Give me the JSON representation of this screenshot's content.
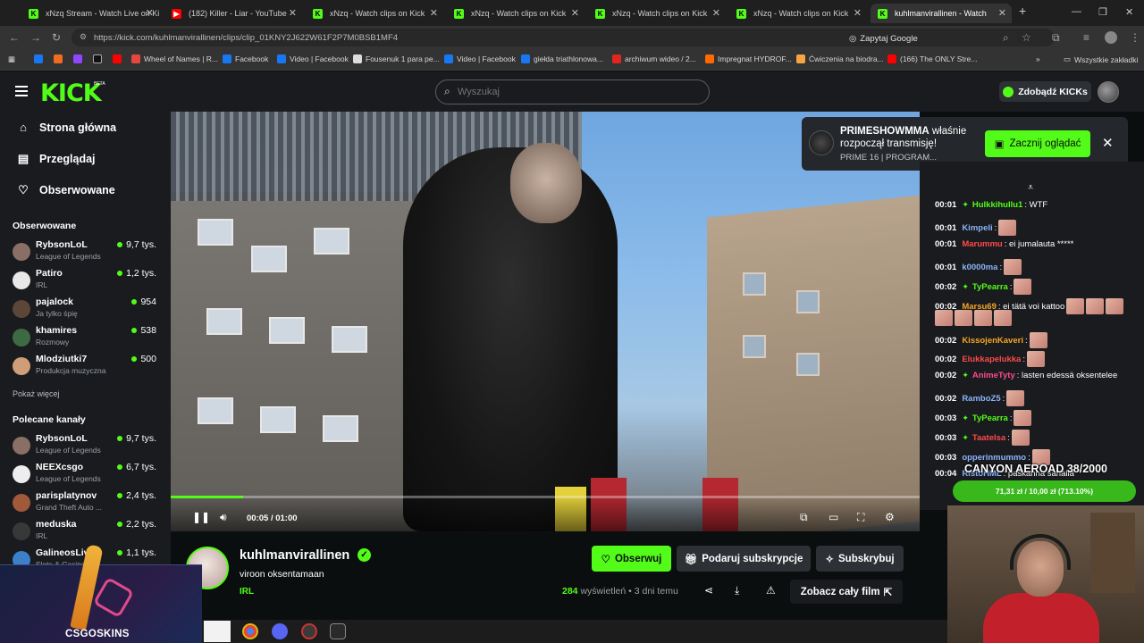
{
  "browser": {
    "tabs": [
      {
        "title": "xNzq Stream - Watch Live on Kick",
        "color": "#53fc18"
      },
      {
        "title": "(182) Killer - Liar - YouTube",
        "color": "#ff0000"
      },
      {
        "title": "xNzq - Watch clips on Kick",
        "color": "#53fc18"
      },
      {
        "title": "xNzq - Watch clips on Kick",
        "color": "#53fc18"
      },
      {
        "title": "xNzq - Watch clips on Kick",
        "color": "#53fc18"
      },
      {
        "title": "xNzq - Watch clips on Kick",
        "color": "#53fc18"
      },
      {
        "title": "kuhlmanvirallinen - Watch",
        "color": "#53fc18"
      }
    ],
    "url": "https://kick.com/kuhlmanvirallinen/clips/clip_01KNY2J622W61F2P7M0BSB1MF4",
    "ask_google": "Zapytaj Google",
    "bookmarks": [
      {
        "label": "Wheel of Names | R...",
        "color": "#e5463d"
      },
      {
        "label": "Facebook",
        "color": "#1877f2"
      },
      {
        "label": "Video | Facebook",
        "color": "#1877f2"
      },
      {
        "label": "Fousenuk 1 para pe...",
        "color": "#dddddd"
      },
      {
        "label": "Video | Facebook",
        "color": "#1877f2"
      },
      {
        "label": "giełda triathlonowa...",
        "color": "#1877f2"
      },
      {
        "label": "archiwum wideo / 2...",
        "color": "#e0261e"
      },
      {
        "label": "Impregnat HYDROF...",
        "color": "#ff6a00"
      },
      {
        "label": "Ćwiczenia na biodra...",
        "color": "#f4a640"
      },
      {
        "label": "(166) The ONLY Stre...",
        "color": "#ff0000"
      }
    ],
    "all_bookmarks": "Wszystkie zakładki"
  },
  "header": {
    "logo": "KICK",
    "logo_beta": "BETA",
    "search_placeholder": "Wyszukaj",
    "kicks_button": "Zdobądź KICKs"
  },
  "sidebar": {
    "nav": [
      {
        "label": "Strona główna",
        "icon": "home-icon"
      },
      {
        "label": "Przeglądaj",
        "icon": "browse-icon"
      },
      {
        "label": "Obserwowane",
        "icon": "heart-icon"
      }
    ],
    "followed_title": "Obserwowane",
    "followed": [
      {
        "name": "RybsonLoL",
        "category": "League of Legends",
        "viewers": "9,7 tys.",
        "color": "#8a6f66"
      },
      {
        "name": "Patiro",
        "category": "IRL",
        "viewers": "1,2 tys.",
        "color": "#e8e8e8"
      },
      {
        "name": "pajalock",
        "category": "Ja tylko śpię",
        "viewers": "954",
        "color": "#5c4638"
      },
      {
        "name": "khamires",
        "category": "Rozmowy",
        "viewers": "538",
        "color": "#3d6a43"
      },
      {
        "name": "Mlodziutki7",
        "category": "Produkcja muzyczna",
        "viewers": "500",
        "color": "#cf9e78"
      }
    ],
    "show_more": "Pokaż więcej",
    "recommended_title": "Polecane kanały",
    "recommended": [
      {
        "name": "RybsonLoL",
        "category": "League of Legends",
        "viewers": "9,7 tys.",
        "color": "#8a6f66"
      },
      {
        "name": "NEEXcsgo",
        "category": "League of Legends",
        "viewers": "6,7 tys.",
        "color": "#ededed"
      },
      {
        "name": "parisplatynov",
        "category": "Grand Theft Auto ...",
        "viewers": "2,4 tys.",
        "color": "#a05a3a"
      },
      {
        "name": "meduska",
        "category": "IRL",
        "viewers": "2,2 tys.",
        "color": "#383838"
      },
      {
        "name": "GalineosLive",
        "category": "Slots & Casino",
        "viewers": "1,1 tys.",
        "color": "#3b80c9"
      }
    ]
  },
  "player": {
    "time_current": "00:05",
    "time_total": "01:00",
    "progress": 0.097
  },
  "notification": {
    "streamer": "PRIMESHOWMMA",
    "text": "właśnie rozpoczął transmisję!",
    "subtitle": "PRIME 16 | PROGRAM...",
    "button": "Zacznij oglądać"
  },
  "chat": {
    "messages": [
      {
        "time": "00:01",
        "user": "Hulkkihullu1",
        "color": "#53fc18",
        "badge": true,
        "text": ": WTF",
        "emotes": 0
      },
      {
        "time": "00:01",
        "user": "Kimpeli",
        "color": "#8ab4f8",
        "badge": false,
        "text": ":",
        "emotes": 1
      },
      {
        "time": "00:01",
        "user": "Marummu",
        "color": "#ff4a4a",
        "badge": false,
        "text": ": ei jumalauta *****",
        "emotes": 0
      },
      {
        "time": "00:01",
        "user": "k0000ma",
        "color": "#8ab4f8",
        "badge": false,
        "text": ":",
        "emotes": 1
      },
      {
        "time": "00:02",
        "user": "TyPearra",
        "color": "#53fc18",
        "badge": true,
        "text": ":",
        "emotes": 1
      },
      {
        "time": "00:02",
        "user": "Marsu69",
        "color": "#f5a623",
        "badge": false,
        "text": ": ei tätä voi kattoo",
        "emotes": 3
      },
      {
        "time": "00:02",
        "user": "KissojenKaveri",
        "color": "#f5a623",
        "badge": false,
        "text": ":",
        "emotes": 1
      },
      {
        "time": "00:02",
        "user": "Elukkapelukka",
        "color": "#ff4a4a",
        "badge": false,
        "text": ":",
        "emotes": 1
      },
      {
        "time": "00:02",
        "user": "AnimeTyty",
        "color": "#ff4a8a",
        "badge": true,
        "text": ": lasten edessä oksentelee",
        "emotes": 0
      },
      {
        "time": "00:02",
        "user": "RamboZ5",
        "color": "#8ab4f8",
        "badge": false,
        "text": ":",
        "emotes": 1
      },
      {
        "time": "00:03",
        "user": "TyPearra",
        "color": "#53fc18",
        "badge": true,
        "text": ":",
        "emotes": 1
      },
      {
        "time": "00:03",
        "user": "Taatelsa",
        "color": "#ff4a4a",
        "badge": true,
        "text": ":",
        "emotes": 1
      },
      {
        "time": "00:03",
        "user": "opperinmummo",
        "color": "#8ab4f8",
        "badge": false,
        "text": ":",
        "emotes": 1
      },
      {
        "time": "00:04",
        "user": "RistoHML",
        "color": "#8ab4f8",
        "badge": false,
        "text": ": paskahha sahalla",
        "emotes": 0
      }
    ],
    "emote_row_extra": 4
  },
  "overlay": {
    "canyon_title": "CANYON AEROAD 38/2000",
    "canyon_progress": "71,31 zł / 10,00 zł (713.10%)",
    "csgo_label": "CSGOSKINS"
  },
  "channel": {
    "name": "kuhlmanvirallinen",
    "clip_title": "viroon oksentamaan",
    "category": "IRL",
    "follow_label": "Obserwuj",
    "gift_label": "Podaruj subskrypcje",
    "sub_label": "Subskrybuj",
    "views_count": "284",
    "views_label": "wyświetleń",
    "age": "• 3 dni temu",
    "full_movie_label": "Zobacz cały film"
  }
}
